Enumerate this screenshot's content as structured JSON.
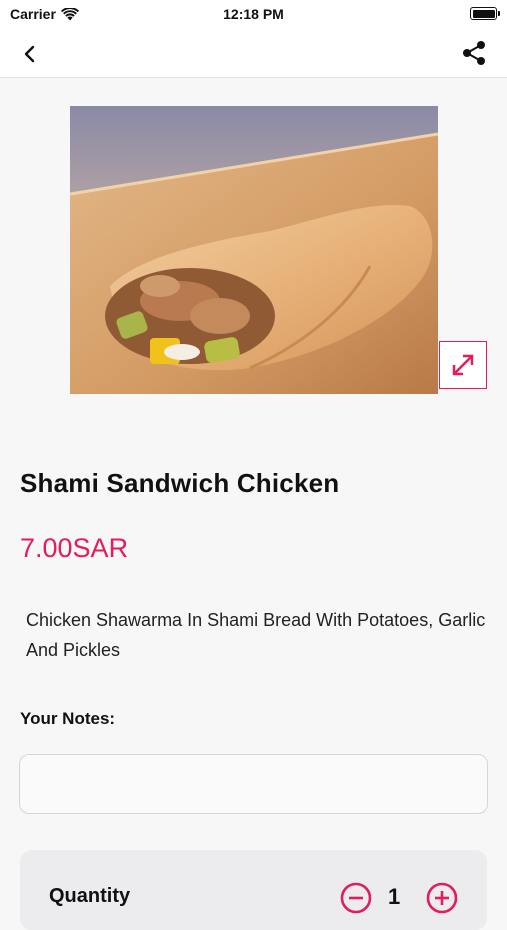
{
  "status_bar": {
    "carrier": "Carrier",
    "time": "12:18 PM",
    "battery_level": 1.0
  },
  "nav": {
    "back_icon": "chevron-left-icon",
    "share_icon": "share-icon"
  },
  "product": {
    "image_alt": "shawarma-wrap-photo",
    "expand_icon": "expand-icon",
    "title": "Shami Sandwich Chicken",
    "price": "7.00SAR",
    "description": "Chicken Shawarma In Shami Bread With Potatoes, Garlic And Pickles"
  },
  "notes": {
    "label": "Your Notes:",
    "value": "",
    "placeholder": ""
  },
  "quantity": {
    "label": "Quantity",
    "value": "1",
    "minus_icon": "minus-circle-icon",
    "plus_icon": "plus-circle-icon"
  },
  "colors": {
    "accent": "#e41c5a",
    "background": "#f7f7f8"
  }
}
